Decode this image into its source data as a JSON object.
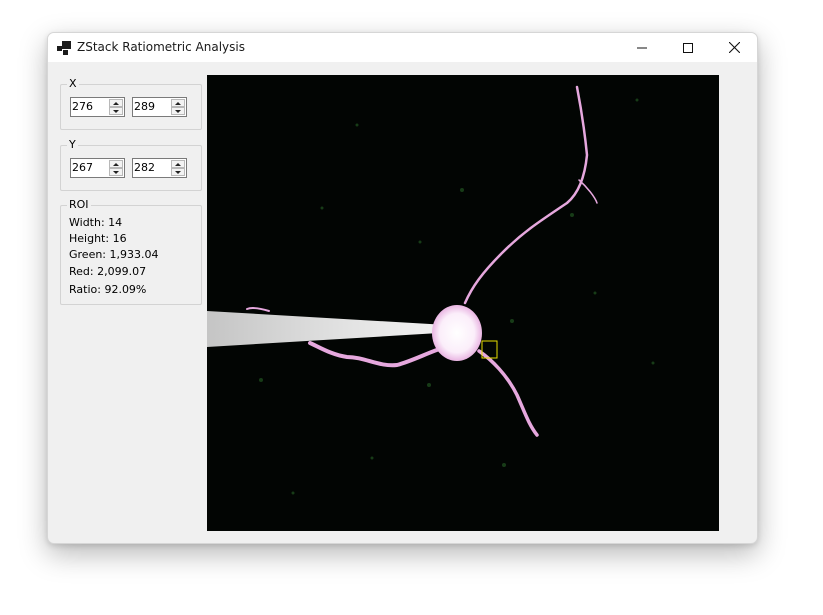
{
  "window": {
    "title": "ZStack Ratiometric Analysis"
  },
  "icons": {
    "app": "app-window-icon",
    "minimize": "minimize-icon",
    "maximize": "maximize-icon",
    "close": "close-icon"
  },
  "x_group": {
    "label": "X",
    "min": "276",
    "max": "289"
  },
  "y_group": {
    "label": "Y",
    "min": "267",
    "max": "282"
  },
  "roi": {
    "label": "ROI",
    "width": "Width: 14",
    "height": "Height: 16",
    "green": "Green: 1,933.04",
    "red": "Red: 2,099.07",
    "ratio": "Ratio: 92.09%"
  },
  "colors": {
    "window_bg": "#f0f0f0",
    "image_bg": "#020503",
    "roi_box": "#e8e000",
    "cell_fill": "#f6e8f4",
    "dendrite": "#e4a4dc"
  }
}
